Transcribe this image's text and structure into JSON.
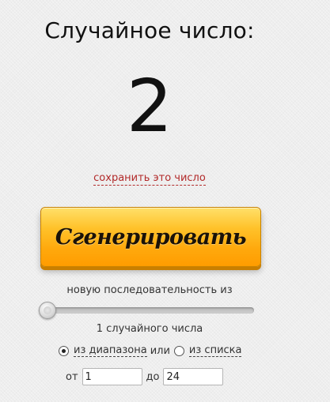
{
  "result": {
    "title": "Случайное число:",
    "number": "2",
    "save_link": "сохранить это число"
  },
  "generate_button": {
    "label": "Сгенерировать",
    "color": "#ffb31a"
  },
  "sequence": {
    "label": "новую последовательность из",
    "slider_fraction": 0.0,
    "count_text": "1 случайного числа"
  },
  "mode": {
    "option_range": "из диапазона",
    "or_text": "или",
    "option_list": "из списка",
    "selected": "range"
  },
  "range": {
    "from_label": "от",
    "from_value": "1",
    "to_label": "до",
    "to_value": "24"
  }
}
